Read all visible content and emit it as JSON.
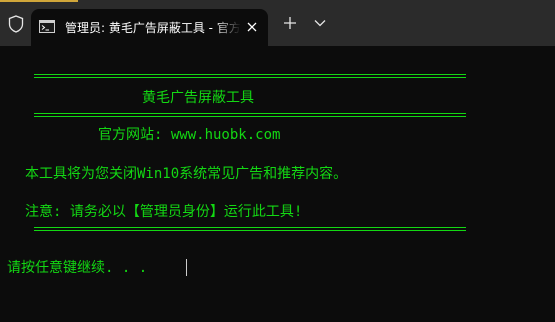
{
  "window": {
    "tab_title": "管理员: 黄毛广告屏蔽工具 - 官方网站: www.huobk.com",
    "icons": {
      "shield": "shield-icon",
      "cmd": "cmd-icon",
      "close": "close-icon",
      "new_tab": "plus-icon",
      "dropdown": "chevron-down-icon"
    }
  },
  "terminal": {
    "title": "黄毛广告屏蔽工具",
    "site": "官方网站: www.huobk.com",
    "desc": "本工具将为您关闭Win10系统常见广告和推荐内容。",
    "notice": "注意: 请务必以【管理员身份】运行此工具!",
    "prompt": "请按任意键继续. . .",
    "text_color": "#13d813"
  }
}
